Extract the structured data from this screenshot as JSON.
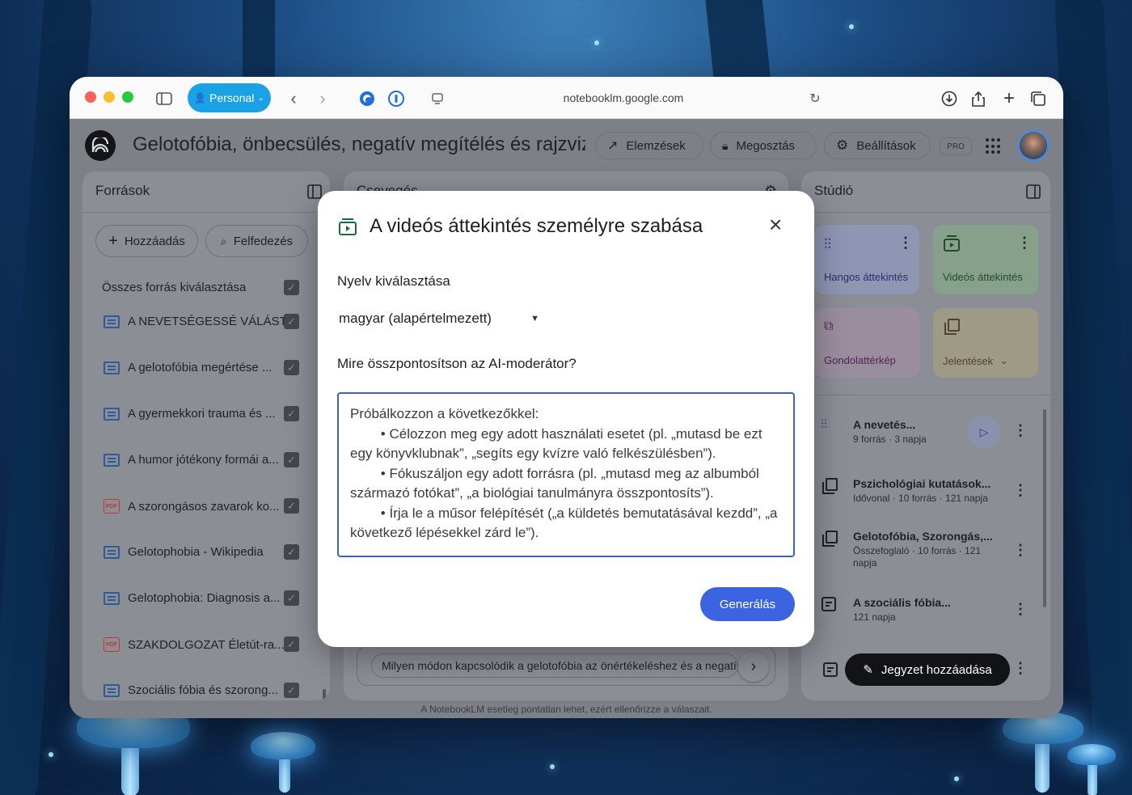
{
  "browser": {
    "profile_label": "Personal",
    "url": "notebooklm.google.com"
  },
  "app": {
    "title": "Gelotofóbia, önbecsülés, negatív megítélés és rajzvizsgálat",
    "analytics_label": "Elemzések",
    "share_label": "Megosztás",
    "settings_label": "Beállítások",
    "pro_badge": "PRO"
  },
  "sources": {
    "title": "Források",
    "add_label": "Hozzáadás",
    "discover_label": "Felfedezés",
    "select_all_label": "Összes forrás kiválasztása",
    "items": [
      {
        "label": "A NEVETSÉGESSÉ VÁLÁST...",
        "type": "doc"
      },
      {
        "label": "A gelotofóbia megértése ...",
        "type": "doc"
      },
      {
        "label": "A gyermekkori trauma és ...",
        "type": "doc"
      },
      {
        "label": "A humor jótékony formái a...",
        "type": "doc"
      },
      {
        "label": "A szorongásos zavarok ko...",
        "type": "pdf"
      },
      {
        "label": "Gelotophobia - Wikipedia",
        "type": "doc"
      },
      {
        "label": "Gelotophobia: Diagnosis a...",
        "type": "doc"
      },
      {
        "label": "SZAKDOLGOZAT Életút-ra...",
        "type": "pdf"
      },
      {
        "label": "Szociális fóbia és szorong...",
        "type": "doc"
      }
    ]
  },
  "chat": {
    "title": "Csevegés",
    "input_value": "Milyen módon kapcsolódik a gelotofóbia az önértékeléshez és a negatív",
    "footer_note": "A NotebookLM esetleg pontatlan lehet, ezért ellenőrizze a válaszait."
  },
  "studio": {
    "title": "Stúdió",
    "cards": [
      {
        "label": "Hangos áttekintés",
        "color": "#8f95b3"
      },
      {
        "label": "Videós áttekintés",
        "color": "#87a08c"
      },
      {
        "label": "Gondolattérkép",
        "color": "#9a8e9e"
      },
      {
        "label": "Jelentések",
        "color": "#9e9a85"
      }
    ],
    "items": [
      {
        "title": "A nevetés...",
        "sub": "9 forrás · 3 napja"
      },
      {
        "title": "Pszichológiai kutatások...",
        "sub": "Idővonal · 10 forrás · 121 napja"
      },
      {
        "title": "Gelotofóbia, Szorongás,...",
        "sub": "Összefoglaló · 10 forrás · 121 napja"
      },
      {
        "title": "A szociális fóbia...",
        "sub": "121 napja"
      }
    ],
    "add_note_label": "Jegyzet hozzáadása"
  },
  "modal": {
    "title": "A videós áttekintés személyre szabása",
    "language_label": "Nyelv kiválasztása",
    "language_value": "magyar (alapértelmezett)",
    "focus_label": "Mire összpontosítson az AI-moderátor?",
    "textarea_placeholder": "Próbálkozzon a következőkkel:\n        • Célozzon meg egy adott használati esetet (pl. „mutasd be ezt egy könyvklubnak”, „segíts egy kvízre való felkészülésben”).\n        • Fókuszáljon egy adott forrásra (pl. „mutasd meg az albumból származó fotókat”, „a biológiai tanulmányra összpontosíts”).\n        • Írja le a műsor felépítését („a küldetés bemutatásával kezdd”, „a következő lépésekkel zárd le”).",
    "generate_label": "Generálás"
  }
}
